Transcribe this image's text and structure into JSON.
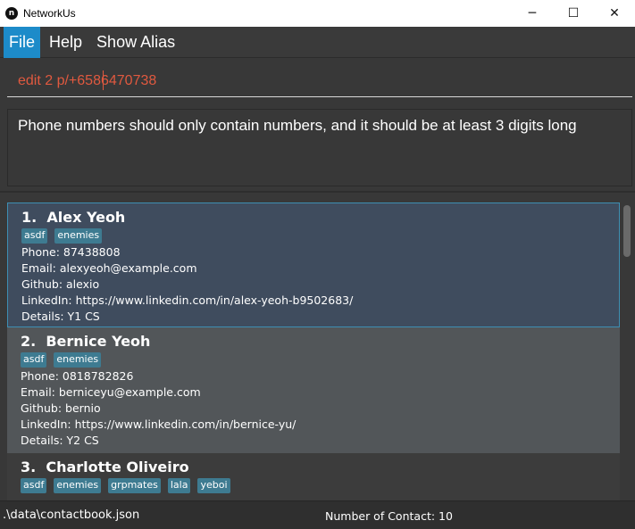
{
  "window": {
    "title": "NetworkUs",
    "app_icon_glyph": "n",
    "minimize_glyph": "─",
    "maximize_glyph": "☐",
    "close_glyph": "✕"
  },
  "menu": {
    "items": [
      "File",
      "Help",
      "Show Alias"
    ]
  },
  "command": {
    "value": "edit 2 p/+6586470738"
  },
  "result": {
    "message": "Phone numbers should only contain numbers, and it should be at least 3 digits long"
  },
  "persons": [
    {
      "index": "1.",
      "name": "Alex Yeoh",
      "tags": [
        "asdf",
        "enemies"
      ],
      "phone": "Phone: 87438808",
      "email": "Email: alexyeoh@example.com",
      "github": "Github: alexio",
      "linkedin": "LinkedIn: https://www.linkedin.com/in/alex-yeoh-b9502683/",
      "details": "Details: Y1 CS"
    },
    {
      "index": "2.",
      "name": "Bernice Yeoh",
      "tags": [
        "asdf",
        "enemies"
      ],
      "phone": "Phone: 0818782826",
      "email": "Email: berniceyu@example.com",
      "github": "Github: bernio",
      "linkedin": "LinkedIn: https://www.linkedin.com/in/bernice-yu/",
      "details": "Details: Y2 CS"
    },
    {
      "index": "3.",
      "name": "Charlotte Oliveiro",
      "tags": [
        "asdf",
        "enemies",
        "grpmates",
        "lala",
        "yeboi"
      ]
    }
  ],
  "status": {
    "path": ".\\data\\contactbook.json",
    "count": "Number of Contact: 10"
  },
  "colors": {
    "accent": "#1d8bc9",
    "command_text": "#e0593f",
    "selected_card": "#3f4c5e",
    "tag": "#3e7b91"
  }
}
